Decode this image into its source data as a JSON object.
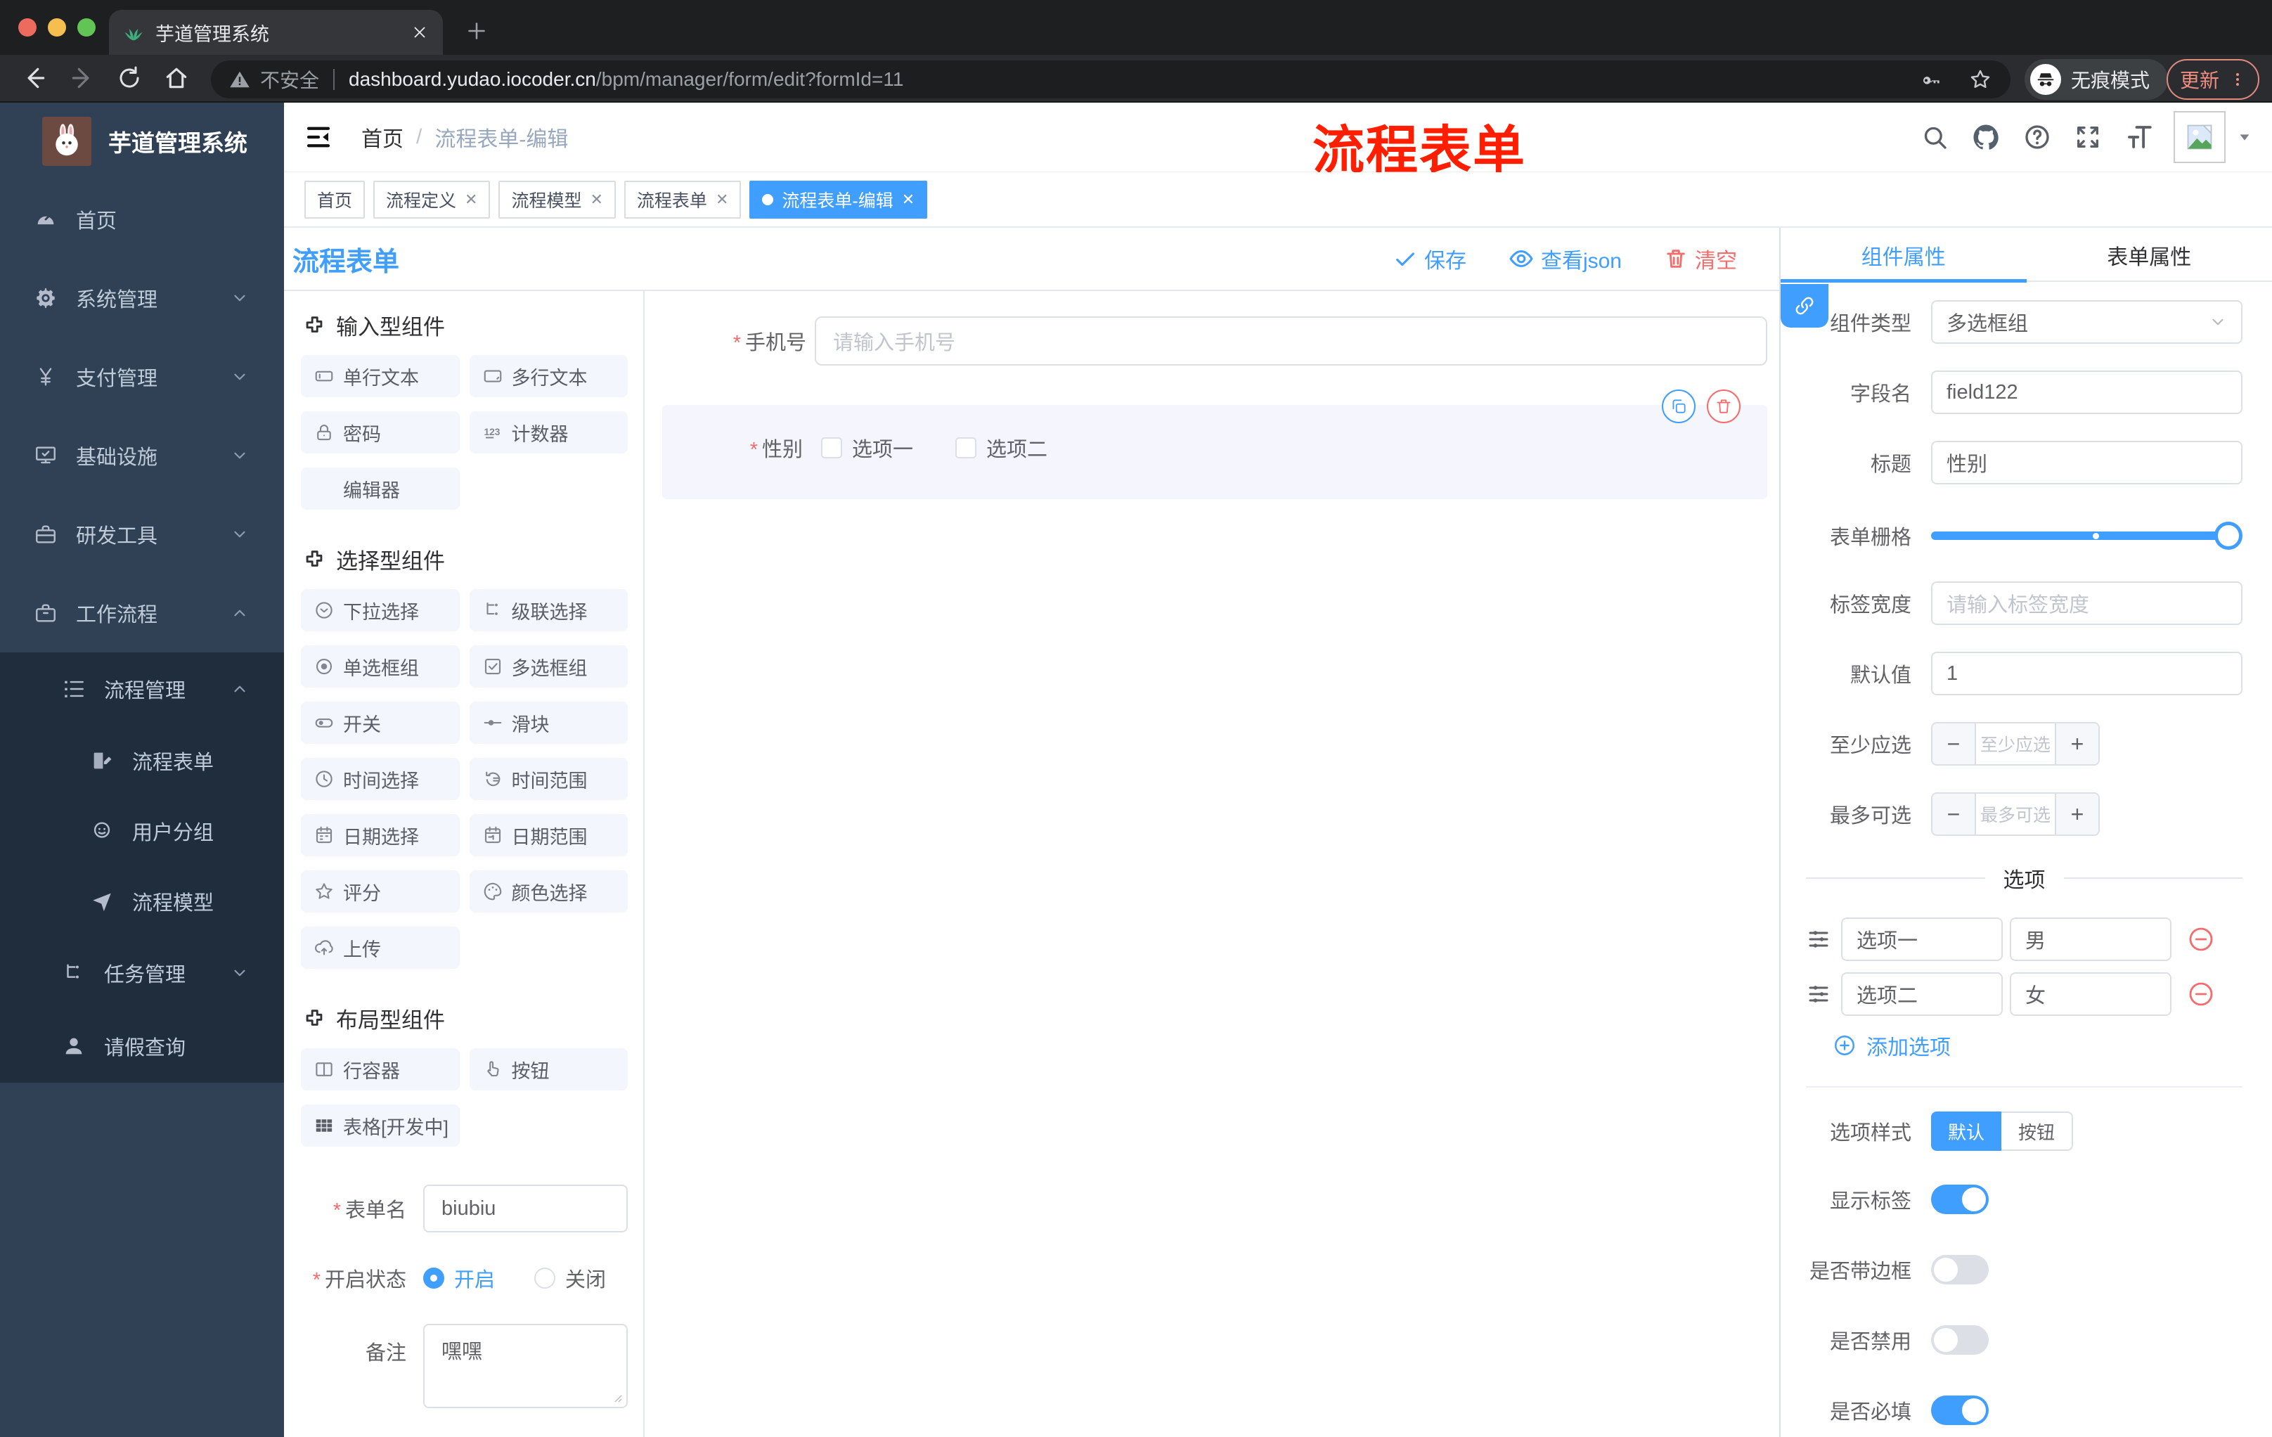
{
  "colors": {
    "primary": "#409eff",
    "danger": "#f56c6c",
    "annotation_red": "#ff1f00",
    "sidebar_bg": "#304156",
    "sidebar_submenu_bg": "#1f2d3d",
    "chrome_dark": "#1e1f21"
  },
  "chrome": {
    "tab_title": "芋道管理系统",
    "security_label": "不安全",
    "url_host": "dashboard.yudao.iocoder.cn",
    "url_path": "/bpm/manager/form/edit?formId=11",
    "incognito_label": "无痕模式",
    "update_label": "更新"
  },
  "sidebar": {
    "logo_title": "芋道管理系统",
    "items": [
      {
        "label": "首页"
      },
      {
        "label": "系统管理"
      },
      {
        "label": "支付管理"
      },
      {
        "label": "基础设施"
      },
      {
        "label": "研发工具"
      },
      {
        "label": "工作流程"
      }
    ],
    "sub_items": [
      {
        "label": "流程管理"
      },
      {
        "label": "流程表单"
      },
      {
        "label": "用户分组"
      },
      {
        "label": "流程模型"
      },
      {
        "label": "任务管理"
      },
      {
        "label": "请假查询"
      }
    ]
  },
  "header": {
    "breadcrumb_home": "首页",
    "breadcrumb_sep": "/",
    "breadcrumb_current": "流程表单-编辑",
    "annotation": "流程表单"
  },
  "tags": [
    {
      "label": "首页"
    },
    {
      "label": "流程定义"
    },
    {
      "label": "流程模型"
    },
    {
      "label": "流程表单"
    },
    {
      "label": "流程表单-编辑"
    }
  ],
  "editor": {
    "title": "流程表单",
    "actions": {
      "save": "保存",
      "view_json": "查看json",
      "clear": "清空"
    },
    "left": {
      "sections": [
        {
          "title": "输入型组件",
          "items": [
            {
              "label": "单行文本"
            },
            {
              "label": "多行文本"
            },
            {
              "label": "密码"
            },
            {
              "label": "计数器"
            },
            {
              "label": "编辑器"
            }
          ]
        },
        {
          "title": "选择型组件",
          "items": [
            {
              "label": "下拉选择"
            },
            {
              "label": "级联选择"
            },
            {
              "label": "单选框组"
            },
            {
              "label": "多选框组"
            },
            {
              "label": "开关"
            },
            {
              "label": "滑块"
            },
            {
              "label": "时间选择"
            },
            {
              "label": "时间范围"
            },
            {
              "label": "日期选择"
            },
            {
              "label": "日期范围"
            },
            {
              "label": "评分"
            },
            {
              "label": "颜色选择"
            },
            {
              "label": "上传"
            }
          ]
        },
        {
          "title": "布局型组件",
          "items": [
            {
              "label": "行容器"
            },
            {
              "label": "按钮"
            },
            {
              "label": "表格[开发中]"
            }
          ]
        }
      ],
      "form": {
        "name_label": "表单名",
        "name_value": "biubiu",
        "status_label": "开启状态",
        "status_on": "开启",
        "status_off": "关闭",
        "remark_label": "备注",
        "remark_value": "嘿嘿"
      }
    },
    "canvas": {
      "phone_label": "手机号",
      "phone_placeholder": "请输入手机号",
      "gender_label": "性别",
      "gender_options": [
        {
          "label": "选项一"
        },
        {
          "label": "选项二"
        }
      ]
    },
    "props": {
      "tab_component": "组件属性",
      "tab_form": "表单属性",
      "type_label": "组件类型",
      "type_value": "多选框组",
      "field_label": "字段名",
      "field_value": "field122",
      "title_label": "标题",
      "title_value": "性别",
      "grid_label": "表单栅格",
      "label_width_label": "标签宽度",
      "label_width_placeholder": "请输入标签宽度",
      "default_label": "默认值",
      "default_value": "1",
      "min_label": "至少应选",
      "min_placeholder": "至少应选",
      "max_label": "最多可选",
      "max_placeholder": "最多可选",
      "options_divider": "选项",
      "options": [
        {
          "label": "选项一",
          "value": "男"
        },
        {
          "label": "选项二",
          "value": "女"
        }
      ],
      "add_option": "添加选项",
      "style_label": "选项样式",
      "style_default": "默认",
      "style_button": "按钮",
      "switches": [
        {
          "label": "显示标签",
          "on": true
        },
        {
          "label": "是否带边框",
          "on": false
        },
        {
          "label": "是否禁用",
          "on": false
        },
        {
          "label": "是否必填",
          "on": true
        }
      ]
    }
  }
}
